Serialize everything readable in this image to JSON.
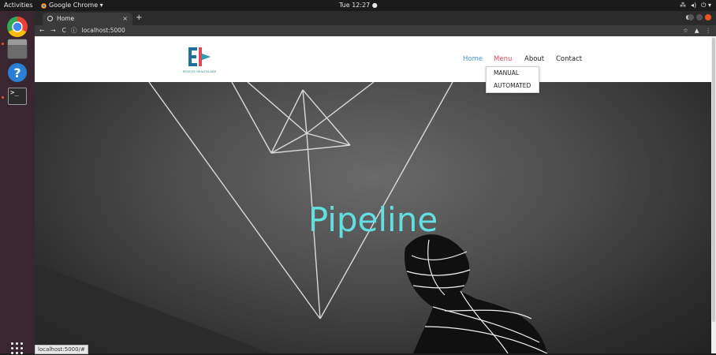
{
  "system_bar": {
    "activities": "Activities",
    "app_name": "Google Chrome ▾",
    "clock": "Tue 12:27 ●",
    "tray_icons": [
      "network-icon",
      "volume-icon",
      "power-icon"
    ]
  },
  "dock": {
    "items": [
      "chrome-icon",
      "files-icon",
      "help-icon",
      "terminal-icon"
    ],
    "apps_grid": "show-applications-icon"
  },
  "browser": {
    "tab_title": "Home",
    "tab_close": "×",
    "new_tab": "+",
    "nav_back": "←",
    "nav_forward": "→",
    "nav_reload": "C",
    "site_info": "ⓘ",
    "url": "localhost:5000",
    "star": "☆",
    "profile": "▲",
    "menu_dots": "⋮"
  },
  "site": {
    "logo_text": "EPISOTE HEALTHCARE",
    "nav": {
      "home": "Home",
      "menu": "Menu",
      "about": "About",
      "contact": "Contact"
    },
    "dropdown": [
      "MANUAL",
      "AUTOMATED"
    ],
    "hero_title": "Pipeline",
    "colors": {
      "home_link": "#3f8fd2",
      "menu_link": "#d94a5a",
      "hero_title": "#62dfe0"
    }
  },
  "status_bar": {
    "hover_url": "localhost:5000/#"
  }
}
